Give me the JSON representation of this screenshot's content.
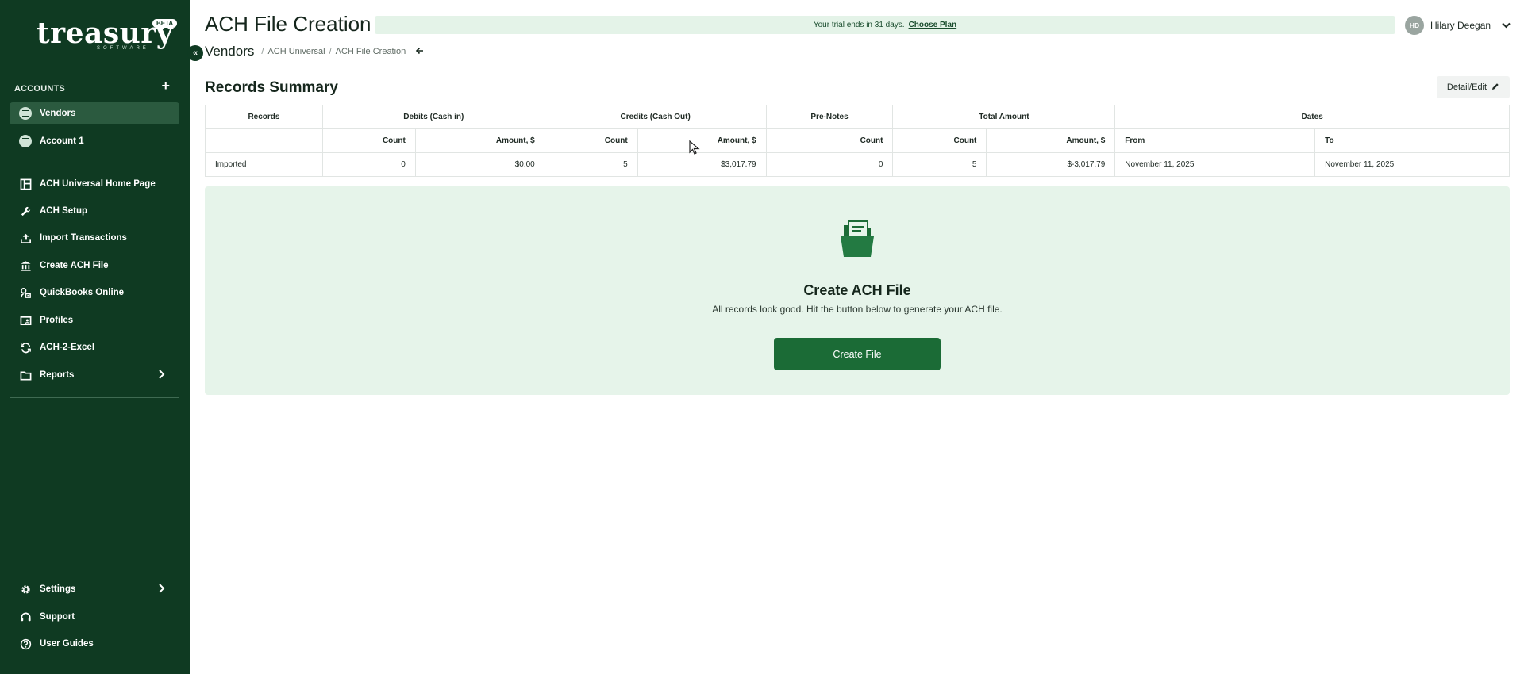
{
  "brand": {
    "logo_text": "treasury",
    "logo_sub": "SOFTWARE",
    "badge": "BETA"
  },
  "sidebar": {
    "accounts_label": "ACCOUNTS",
    "accounts": [
      {
        "label": "Vendors",
        "active": true
      },
      {
        "label": "Account 1",
        "active": false
      }
    ],
    "nav": [
      {
        "label": "ACH Universal Home Page",
        "icon": "layout-icon"
      },
      {
        "label": "ACH Setup",
        "icon": "wrench-icon"
      },
      {
        "label": "Import Transactions",
        "icon": "upload-icon"
      },
      {
        "label": "Create ACH File",
        "icon": "bank-icon"
      },
      {
        "label": "QuickBooks Online",
        "icon": "quickbooks-icon"
      },
      {
        "label": "Profiles",
        "icon": "profile-card-icon"
      },
      {
        "label": "ACH-2-Excel",
        "icon": "sync-icon"
      },
      {
        "label": "Reports",
        "icon": "folder-icon"
      }
    ],
    "footer": [
      {
        "label": "Settings",
        "icon": "gear-icon"
      },
      {
        "label": "Support",
        "icon": "headset-icon"
      },
      {
        "label": "User Guides",
        "icon": "help-circle-icon"
      }
    ]
  },
  "header": {
    "title": "ACH File Creation",
    "trial_text": "Your trial ends in 31 days.",
    "trial_link": "Choose Plan",
    "user_initials": "HD",
    "user_name": "Hilary Deegan"
  },
  "breadcrumb": {
    "root": "Vendors",
    "items": [
      "ACH Universal",
      "ACH File Creation"
    ]
  },
  "summary": {
    "title": "Records Summary",
    "detail_button": "Detail/Edit",
    "group_headers": [
      "Records",
      "Debits (Cash in)",
      "Credits (Cash Out)",
      "Pre-Notes",
      "Total Amount",
      "Dates"
    ],
    "sub_headers": [
      "",
      "Count",
      "Amount, $",
      "Count",
      "Amount, $",
      "Count",
      "Count",
      "Amount, $",
      "From",
      "To"
    ],
    "rows": [
      {
        "label": "Imported",
        "debit_count": "0",
        "debit_amount": "$0.00",
        "credit_count": "5",
        "credit_amount": "$3,017.79",
        "prenote_count": "0",
        "total_count": "5",
        "total_amount": "$-3,017.79",
        "from": "November 11, 2025",
        "to": "November 11, 2025"
      }
    ]
  },
  "create_panel": {
    "title": "Create ACH File",
    "description": "All records look good. Hit the button below to generate your ACH file.",
    "button": "Create File"
  },
  "colors": {
    "sidebar": "#0f3a22",
    "accent": "#1b6b36",
    "panel": "#e6f4ea",
    "trial_bar": "#e4f3e8"
  }
}
